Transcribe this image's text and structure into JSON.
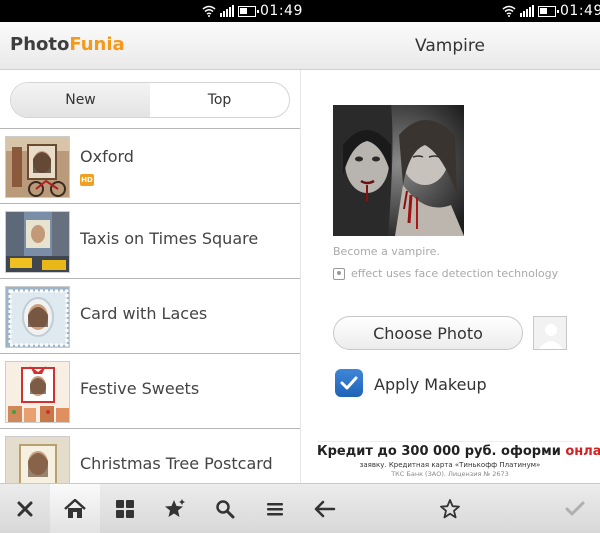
{
  "status_bar": {
    "time_left": "01:49",
    "time_right": "01:49"
  },
  "header": {
    "logo_part1": "Photo",
    "logo_part2": "Funia",
    "title": "Vampire"
  },
  "tabs": [
    {
      "label": "New"
    },
    {
      "label": "Top"
    }
  ],
  "effects": [
    {
      "label": "Oxford",
      "badge": "HD"
    },
    {
      "label": "Taxis on Times Square"
    },
    {
      "label": "Card with Laces"
    },
    {
      "label": "Festive Sweets"
    },
    {
      "label": "Christmas Tree Postcard"
    }
  ],
  "detail": {
    "description": "Become a vampire.",
    "face_note": "effect uses face detection technology",
    "choose_label": "Choose Photo",
    "apply_label": "Apply Makeup",
    "apply_checked": true
  },
  "ad": {
    "line1_a": "Кредит до 300 000 руб. оформи ",
    "line1_b": "онлайн",
    "line2": "заявку. Кредитная карта «Тинькофф Платинум»",
    "line3": "ТКС Банк (ЗАО). Лицензия № 2673"
  },
  "toolbar": {
    "icons": [
      "close-icon",
      "home-icon",
      "grid-icon",
      "star-sparkle-icon",
      "search-icon",
      "menu-icon",
      "back-arrow-icon",
      "star-outline-icon",
      "check-icon"
    ]
  },
  "colors": {
    "logo_accent": "#f39a1a",
    "checkbox_blue": "#2a6fc4",
    "ad_red": "#d42020"
  }
}
